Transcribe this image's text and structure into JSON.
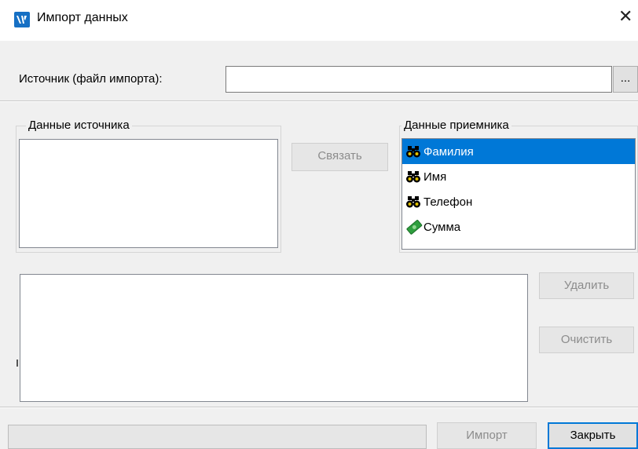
{
  "window": {
    "title": "Импорт данных",
    "close_glyph": "✕"
  },
  "source_file": {
    "label": "Источник (файл импорта):",
    "value": "",
    "browse_label": "..."
  },
  "source_group": {
    "title": "Данные источника",
    "items": []
  },
  "link_button": {
    "label": "Связать",
    "enabled": false
  },
  "target_group": {
    "title": "Данные приемника",
    "items": [
      {
        "label": "Фамилия",
        "icon": "binoculars-icon",
        "selected": true
      },
      {
        "label": "Имя",
        "icon": "binoculars-icon",
        "selected": false
      },
      {
        "label": "Телефон",
        "icon": "binoculars-icon",
        "selected": false
      },
      {
        "label": "Сумма",
        "icon": "money-icon",
        "selected": false
      }
    ]
  },
  "links_list": {
    "items": []
  },
  "delete_button": {
    "label": "Удалить",
    "enabled": false
  },
  "clear_button": {
    "label": "Очистить",
    "enabled": false
  },
  "progress": {
    "value": 0
  },
  "import_button": {
    "label": "Импорт",
    "enabled": false
  },
  "close_button": {
    "label": "Закрыть",
    "enabled": true
  },
  "colors": {
    "selection": "#0078d7",
    "app_icon": "#1670c4"
  }
}
